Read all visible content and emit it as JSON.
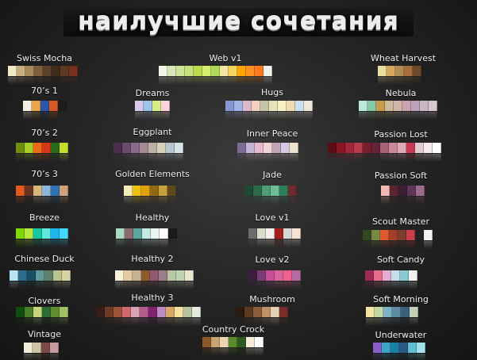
{
  "title": "наилучшие сочетания",
  "palettes": [
    {
      "label": "Swiss Mocha",
      "colors": [
        "#f1e9c8",
        "#c9ad7c",
        "#a8895a",
        "#7e5f3b",
        "#59412a",
        "#3e2c1c",
        "#5a3a23",
        "#7a2e1c"
      ]
    },
    {
      "label": "Web v1",
      "colors": [
        "#f3f5e8",
        "#d7e7b7",
        "#cfe39a",
        "#c6e07b",
        "#bddc4e",
        "#d6ec6c",
        "#b1d85b",
        "#f2e6a2",
        "#f5d55d",
        "#ffa500",
        "#ff9124",
        "#ff7a1f",
        "#f4f0ea"
      ]
    },
    {
      "label": "Wheat Harvest",
      "colors": [
        "#ebdca0",
        "#d7a95f",
        "#b08c57",
        "#a86d3c",
        "#6b4a29"
      ]
    },
    {
      "label": "70’s 1",
      "colors": [
        "#f4efe0",
        "#e9a64a",
        "#2b57a6",
        "#d45a26",
        "#1c1c1c"
      ]
    },
    {
      "label": "Dreams",
      "colors": [
        "#d9c9e9",
        "#9fc3e8",
        "#d7ee87",
        "#fbd3db"
      ]
    },
    {
      "label": "Hugs",
      "colors": [
        "#8996d4",
        "#a2b3e6",
        "#dcb7ce",
        "#f2d0c1",
        "#c4c4a8",
        "#eae3b9",
        "#f6f1c7",
        "#f2dcb4",
        "#c9e2f2",
        "#efe7d7"
      ]
    },
    {
      "label": "Nebula",
      "colors": [
        "#bce8d8",
        "#86c9a6",
        "#c99c4d",
        "#cbbb9a",
        "#cfb6a9",
        "#cba3b0",
        "#bda3ba",
        "#c8b8c4",
        "#d8c7d2"
      ]
    },
    {
      "label": "70’s 2",
      "colors": [
        "#6f8e0e",
        "#a7ce24",
        "#ea6a17",
        "#d63816",
        "#2a6b18",
        "#c5dc2a"
      ]
    },
    {
      "label": "Eggplant",
      "colors": [
        "#4a2d4c",
        "#6b4a6e",
        "#8a6b8b",
        "#a38a95",
        "#bcb0a5",
        "#d8d1b7",
        "#b6c7d0",
        "#d7e4ea"
      ]
    },
    {
      "label": "Inner Peace",
      "colors": [
        "#7d6a95",
        "#c3b4d5",
        "#e7b7cf",
        "#f3d3d3",
        "#c2a5b6",
        "#d8c9e3",
        "#eee3cf"
      ]
    },
    {
      "label": "Passion Lost",
      "colors": [
        "#5d0c14",
        "#8a1422",
        "#a2263a",
        "#b73b4d",
        "#7b1e2f",
        "#642336",
        "#a86278",
        "#c9899a",
        "#e1a8b6",
        "#c73853",
        "#e2c9d0",
        "#f7e9ed",
        "#ffffff"
      ]
    },
    {
      "label": "70’s 3",
      "colors": [
        "#e25a1c",
        "#6a3520",
        "#d8b67a",
        "#8eb6d9",
        "#2e74b5",
        "#cfa27a"
      ]
    },
    {
      "label": "Golden Elements",
      "colors": [
        "#f3ecb7",
        "#f0c10d",
        "#e0a10e",
        "#8e6a12",
        "#c9a13a",
        "#5e4a1b"
      ]
    },
    {
      "label": "Jade",
      "colors": [
        "#1e4a33",
        "#2d6a4a",
        "#4f9d77",
        "#6dbc95",
        "#2c7f5a",
        "#6e2a2c"
      ]
    },
    {
      "label": "Passion Soft",
      "colors": [
        "#f2b8b0",
        "#5a2531",
        "#3d1e39",
        "#5e3554",
        "#9c6a8e"
      ]
    },
    {
      "label": "Breeze",
      "colors": [
        "#80d800",
        "#b8e93c",
        "#14c7a2",
        "#5de8e0",
        "#1fb6ef",
        "#43d9ff"
      ]
    },
    {
      "label": "Healthy",
      "colors": [
        "#a8d9c3",
        "#8a6a6f",
        "#5ea6a0",
        "#c7e7e2",
        "#e9f3f1",
        "#ffffff",
        "#1a1a1a"
      ]
    },
    {
      "label": "Love v1",
      "colors": [
        "#6b6b6b",
        "#d7dccc",
        "#f4f0e7",
        "#a71e1e",
        "#d7d7d7",
        "#f6e2d5"
      ]
    },
    {
      "label": "Scout Master",
      "colors": [
        "#314a1e",
        "#758a44",
        "#e05a2d",
        "#a03f2a",
        "#7f3d2d",
        "#c93e4d",
        "#222222",
        "#f2f2f2"
      ]
    },
    {
      "label": "Chinese Duck",
      "colors": [
        "#b8e3f2",
        "#2a6d88",
        "#1b4e63",
        "#5e9a9a",
        "#5e7f6b",
        "#b8c68e",
        "#d8d2a2"
      ]
    },
    {
      "label": "Healthy 2",
      "colors": [
        "#f5f2d8",
        "#e3c9a0",
        "#c4b390",
        "#8c5a2b",
        "#8e5a73",
        "#9b7d8a",
        "#b7caa6",
        "#bfd2b2",
        "#e9e4cd"
      ]
    },
    {
      "label": "Love v2",
      "colors": [
        "#3d1e3f",
        "#7a3b76",
        "#c54d9a",
        "#d9659f",
        "#ef5f8f",
        "#b36ca2"
      ]
    },
    {
      "label": "Soft Candy",
      "colors": [
        "#9a2d58",
        "#e76d8a",
        "#e8acd4",
        "#c2e0e9",
        "#8bc8d5",
        "#f2f2f2"
      ]
    },
    {
      "label": "Clovers",
      "colors": [
        "#0f4d12",
        "#4a7e29",
        "#c7d47c",
        "#2c6b32",
        "#5e8f30",
        "#a2c065"
      ]
    },
    {
      "label": "Healthy 3",
      "colors": [
        "#3a1c1a",
        "#6c3b28",
        "#9f5438",
        "#d06a6f",
        "#d8a1b4",
        "#b15d8a",
        "#82226e",
        "#bd8bc9",
        "#d9a765",
        "#f3e2a0",
        "#b6c1a0",
        "#e4eadf"
      ]
    },
    {
      "label": "Mushroom",
      "colors": [
        "#2b1a10",
        "#5c3a22",
        "#8c5d3b",
        "#bf9267",
        "#e6d0b3",
        "#7c2b2b"
      ]
    },
    {
      "label": "Soft Morning",
      "colors": [
        "#f1e5a0",
        "#c3d9a5",
        "#7cb3c4",
        "#5e8ca2",
        "#3d5f7e",
        "#c5cfb8"
      ]
    },
    {
      "label": "Vintage",
      "colors": [
        "#f2edd8",
        "#cfc4a3",
        "#7c4b49",
        "#c79aa0"
      ]
    },
    {
      "label": "Country Crock",
      "colors": [
        "#8a5a2a",
        "#c9a36d",
        "#e9d6b0",
        "#5c8a2e",
        "#2c5a1f",
        "#f4ecda",
        "#ffffff"
      ]
    },
    {
      "label": "Underwater",
      "colors": [
        "#8a5ec9",
        "#3da3c9",
        "#1c7fa6",
        "#2b5a83",
        "#61bfd1",
        "#a6e0ea"
      ]
    }
  ]
}
